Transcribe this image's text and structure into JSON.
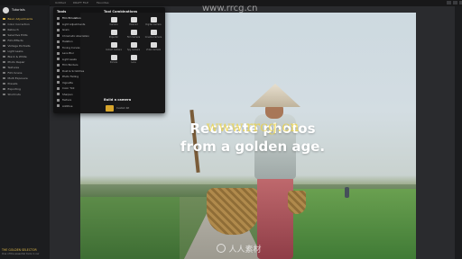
{
  "window": {
    "title": "Tutorials",
    "watermark_top": "www.rrcg.cn"
  },
  "topbar": {
    "tabs": [
      "Untitled",
      "DRAFT FILE",
      "Favorites"
    ]
  },
  "sidebar": {
    "title": "Tutorials",
    "items": [
      {
        "label": "Basic Adjustments",
        "active": true
      },
      {
        "label": "Color Correction",
        "active": false
      },
      {
        "label": "Retouch",
        "active": false
      },
      {
        "label": "Selective Edits",
        "active": false
      },
      {
        "label": "Film Effects",
        "active": false
      },
      {
        "label": "Vintage Portraits",
        "active": false
      },
      {
        "label": "Light Leaks",
        "active": false
      },
      {
        "label": "Black & White",
        "active": false
      },
      {
        "label": "Photo Repair",
        "active": false
      },
      {
        "label": "Textures",
        "active": false
      },
      {
        "label": "Film Scans",
        "active": false
      },
      {
        "label": "Multi Exposure",
        "active": false
      },
      {
        "label": "Presets",
        "active": false
      },
      {
        "label": "Exporting",
        "active": false
      },
      {
        "label": "Shortcuts",
        "active": false
      }
    ],
    "footer": {
      "heading": "THE GOLDEN SELECTOR",
      "text": "One of the essential tools in our"
    }
  },
  "menu": {
    "tools_heading": "Tools",
    "tools": [
      {
        "label": "Film Emulation"
      },
      {
        "label": "Light Adjustments"
      },
      {
        "label": "Grain"
      },
      {
        "label": "Chromatic Aberration"
      },
      {
        "label": "Halation"
      },
      {
        "label": "Toning Curves"
      },
      {
        "label": "Lens Blur"
      },
      {
        "label": "Light Leaks"
      },
      {
        "label": "Film Borders"
      },
      {
        "label": "Dust & Scratches"
      },
      {
        "label": "Photo Fading"
      },
      {
        "label": "Vignette"
      },
      {
        "label": "Color Tint"
      },
      {
        "label": "Sharpen"
      },
      {
        "label": "Texture"
      },
      {
        "label": "Additive"
      }
    ],
    "combos_heading": "Tool Combinations",
    "combos": [
      {
        "label": "Camera"
      },
      {
        "label": "Polaroid"
      },
      {
        "label": "Digital Camera"
      },
      {
        "label": "Projector"
      },
      {
        "label": "Film Camera"
      },
      {
        "label": "Cinema Camera"
      },
      {
        "label": "Instant Camera"
      },
      {
        "label": "Spy Camera"
      },
      {
        "label": "Video Camera"
      },
      {
        "label": "Pinhole"
      },
      {
        "label": "Lens"
      }
    ],
    "build_heading": "Build a camera",
    "build_item": "Custom Kit"
  },
  "photo": {
    "headline_line1": "Recreate photos",
    "headline_line2": "from a golden age.",
    "watermark_mid": "www.rrcg.cn",
    "watermark_bottom": "人人素材"
  },
  "colors": {
    "accent": "#e0b949",
    "panel": "#121213",
    "sidebar": "#1c1d1f"
  }
}
